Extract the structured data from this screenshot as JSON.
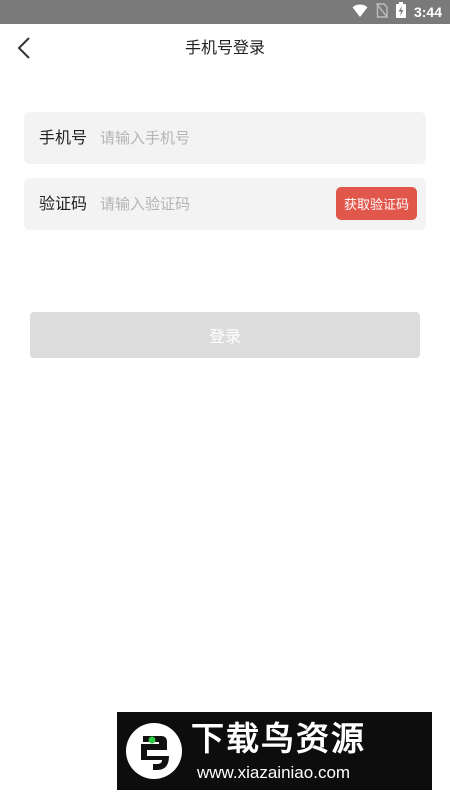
{
  "status_bar": {
    "time": "3:44",
    "icons": [
      "wifi-icon",
      "no-sim-icon",
      "battery-charging-icon"
    ]
  },
  "nav": {
    "back_icon": "chevron-left-icon",
    "title": "手机号登录"
  },
  "form": {
    "phone": {
      "label": "手机号",
      "placeholder": "请输入手机号",
      "value": ""
    },
    "code": {
      "label": "验证码",
      "placeholder": "请输入验证码",
      "value": "",
      "button_label": "获取验证码"
    },
    "login_label": "登录"
  },
  "watermark": {
    "title": "下载鸟资源",
    "url": "www.xiazainiao.com"
  },
  "colors": {
    "status_bar_bg": "#7a7a7a",
    "code_button_bg": "#e2574c",
    "field_bg": "#f3f3f3",
    "login_button_bg": "#dcdcdc",
    "watermark_bg": "#0d0d0d"
  }
}
